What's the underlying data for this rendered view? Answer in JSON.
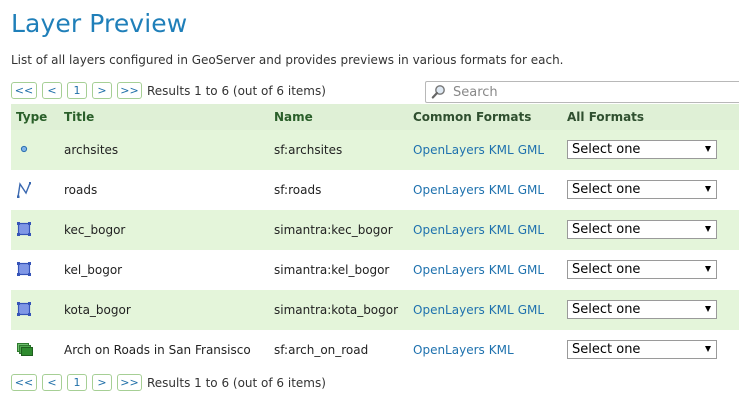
{
  "page": {
    "title": "Layer Preview",
    "description": "List of all layers configured in GeoServer and provides previews in various formats for each."
  },
  "pager": {
    "first": "<<",
    "prev": "<",
    "current": "1",
    "next": ">",
    "last": ">>",
    "info": "Results 1 to 6 (out of 6 items)"
  },
  "search": {
    "placeholder": "Search",
    "value": ""
  },
  "table": {
    "headers": {
      "type": "Type",
      "title": "Title",
      "name": "Name",
      "common": "Common Formats",
      "all": "All Formats"
    },
    "rows": [
      {
        "type_icon": "point-icon",
        "title": "archsites",
        "name": "sf:archsites",
        "formats": [
          "OpenLayers",
          "KML",
          "GML"
        ],
        "all_formats": "Select one"
      },
      {
        "type_icon": "line-icon",
        "title": "roads",
        "name": "sf:roads",
        "formats": [
          "OpenLayers",
          "KML",
          "GML"
        ],
        "all_formats": "Select one"
      },
      {
        "type_icon": "polygon-icon",
        "title": "kec_bogor",
        "name": "simantra:kec_bogor",
        "formats": [
          "OpenLayers",
          "KML",
          "GML"
        ],
        "all_formats": "Select one"
      },
      {
        "type_icon": "polygon-icon",
        "title": "kel_bogor",
        "name": "simantra:kel_bogor",
        "formats": [
          "OpenLayers",
          "KML",
          "GML"
        ],
        "all_formats": "Select one"
      },
      {
        "type_icon": "polygon-icon",
        "title": "kota_bogor",
        "name": "simantra:kota_bogor",
        "formats": [
          "OpenLayers",
          "KML",
          "GML"
        ],
        "all_formats": "Select one"
      },
      {
        "type_icon": "layer-group-icon",
        "title": "Arch on Roads in San Fransisco",
        "name": "sf:arch_on_road",
        "formats": [
          "OpenLayers",
          "KML"
        ],
        "all_formats": "Select one"
      }
    ]
  },
  "colors": {
    "title_blue": "#1f7fb9",
    "row_highlight": "#e4f5da",
    "header_bg": "#dff0d6",
    "link": "#1f72ae"
  }
}
